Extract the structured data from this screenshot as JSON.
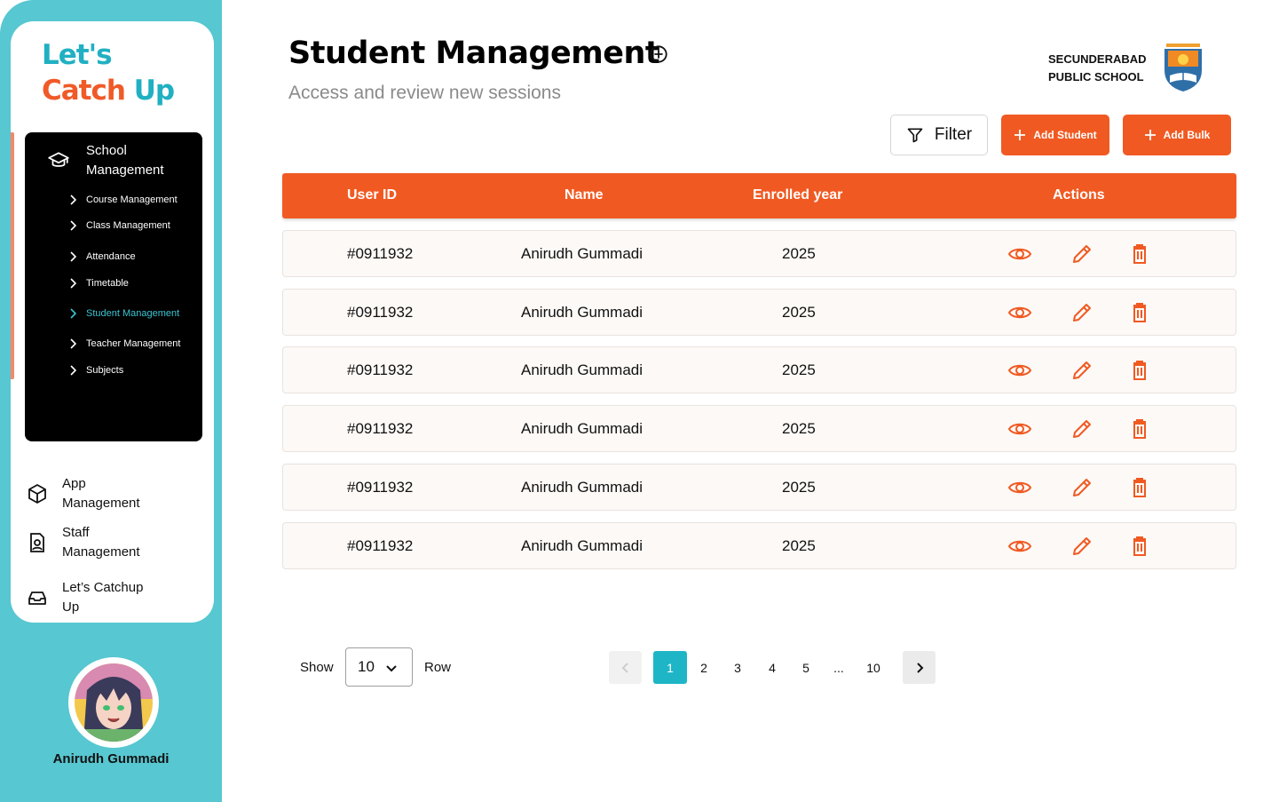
{
  "brand": {
    "line1": "Let's",
    "line2_a": "Catch ",
    "line2_b": "Up"
  },
  "sidebar": {
    "section_title": "School Management",
    "sub_items": [
      {
        "label": "Course Management",
        "active": false
      },
      {
        "label": "Class Management",
        "active": false
      },
      {
        "label": "Attendance",
        "active": false
      },
      {
        "label": "Timetable",
        "active": false
      },
      {
        "label": "Student Management",
        "active": true
      },
      {
        "label": "Teacher Management",
        "active": false
      },
      {
        "label": "Subjects",
        "active": false
      }
    ],
    "menu": [
      {
        "label": "App Management",
        "icon": "cube-icon"
      },
      {
        "label": "Staff Management",
        "icon": "staff-badge-icon"
      },
      {
        "label": "Let’s Catchup Up",
        "icon": "inbox-icon"
      }
    ],
    "user_name": "Anirudh Gummadi"
  },
  "header": {
    "title": "Student Management",
    "subtitle": "Access and review new sessions",
    "school_line1": "SECUNDERABAD",
    "school_line2": "PUBLIC SCHOOL"
  },
  "toolbar": {
    "filter_label": "Filter",
    "add_student_label": "Add Student",
    "add_bulk_label": "Add Bulk"
  },
  "table": {
    "columns": [
      "User ID",
      "Name",
      "Enrolled year",
      "Actions"
    ],
    "rows": [
      {
        "user_id": "#0911932",
        "name": "Anirudh Gummadi",
        "year": "2025"
      },
      {
        "user_id": "#0911932",
        "name": "Anirudh Gummadi",
        "year": "2025"
      },
      {
        "user_id": "#0911932",
        "name": "Anirudh Gummadi",
        "year": "2025"
      },
      {
        "user_id": "#0911932",
        "name": "Anirudh Gummadi",
        "year": "2025"
      },
      {
        "user_id": "#0911932",
        "name": "Anirudh Gummadi",
        "year": "2025"
      },
      {
        "user_id": "#0911932",
        "name": "Anirudh Gummadi",
        "year": "2025"
      }
    ]
  },
  "pagination": {
    "show_label": "Show",
    "rows_value": "10",
    "row_label": "Row",
    "pages": [
      "1",
      "2",
      "3",
      "4",
      "5",
      "...",
      "10"
    ],
    "current_page": "1"
  },
  "colors": {
    "accent": "#f05a22",
    "teal": "#57c7d1",
    "active_teal": "#1eb6c6"
  }
}
